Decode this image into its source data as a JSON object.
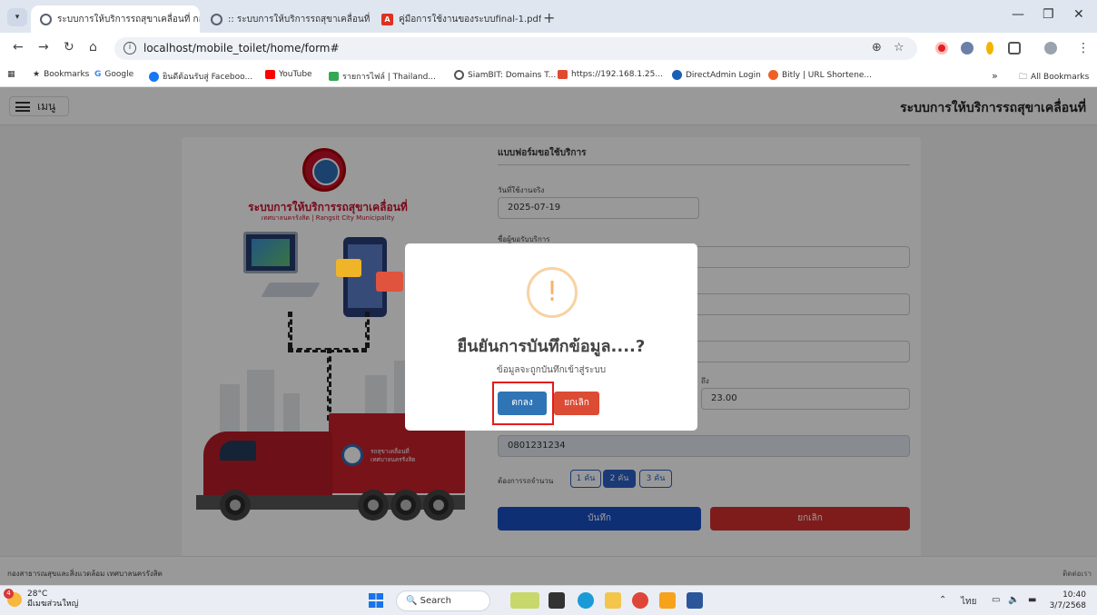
{
  "browser": {
    "tabs": [
      {
        "title": "ระบบการให้บริการรถสุขาเคลื่อนที่ กอ",
        "active": true
      },
      {
        "title": ":: ระบบการให้บริการรถสุขาเคลื่อนที่ ก",
        "active": false
      },
      {
        "title": "คู่มือการใช้งานของระบบfinal-1.pdf",
        "active": false
      }
    ],
    "new_tab": "+",
    "url": "localhost/mobile_toilet/home/form#",
    "bookmarks": [
      "Bookmarks",
      "Google",
      "ยินดีต้อนรับสู่ Faceboo...",
      "YouTube",
      "รายการไฟล์ | Thailand...",
      "SiamBIT: Domains T...",
      "https://192.168.1.25...",
      "DirectAdmin Login",
      "Bitly | URL Shortene..."
    ],
    "overflow": "»",
    "all_bookmarks": "All Bookmarks"
  },
  "app": {
    "menu_label": "เมนู",
    "title": "ระบบการให้บริการรถสุขาเคลื่อนที่",
    "brand_title": "ระบบการให้บริการรถสุขาเคลื่อนที่",
    "brand_sub": "เทศบาลนครรังสิต | Rangsit City Municipality",
    "truck_label": "รถสุขาเคลื่อนที่\nเทศบาลนครรังสิต"
  },
  "form": {
    "title": "แบบฟอร์มขอใช้บริการ",
    "date_label": "วันที่ใช้งานจริง",
    "date_value": "2025-07-19",
    "requester_label": "ชื่อผู้ขอรับบริการ",
    "to_label": "ถึง",
    "to_value": "23.00",
    "phone_value": "0801231234",
    "qty_label": "ต้องการรถจำนวน",
    "qty_options": [
      "1 คัน",
      "2 คัน",
      "3 คัน"
    ],
    "qty_selected": "2 คัน",
    "save_label": "บันทึก",
    "cancel_label": "ยกเลิก"
  },
  "dialog": {
    "icon": "!",
    "title": "ยืนยันการบันทึกข้อมูล....?",
    "text": "ข้อมูลจะถูกบันทึกเข้าสู่ระบบ",
    "ok_label": "ตกลง",
    "cancel_label": "ยกเลิก"
  },
  "footer": {
    "left": "กองสาธารณสุขและสิ่งแวดล้อม เทศบาลนครรังสิต",
    "right": "ติดต่อเรา"
  },
  "taskbar": {
    "badge": "4",
    "temp": "28°C",
    "weather": "มีเมฆส่วนใหญ่",
    "search": "Search",
    "lang": "ไทย",
    "time": "10:40",
    "date": "3/7/2568"
  },
  "colors": {
    "brand_red": "#c8102e",
    "primary_blue": "#2b5fc7",
    "danger_red": "#dc4b34",
    "highlight_box": "#e41b1b"
  }
}
